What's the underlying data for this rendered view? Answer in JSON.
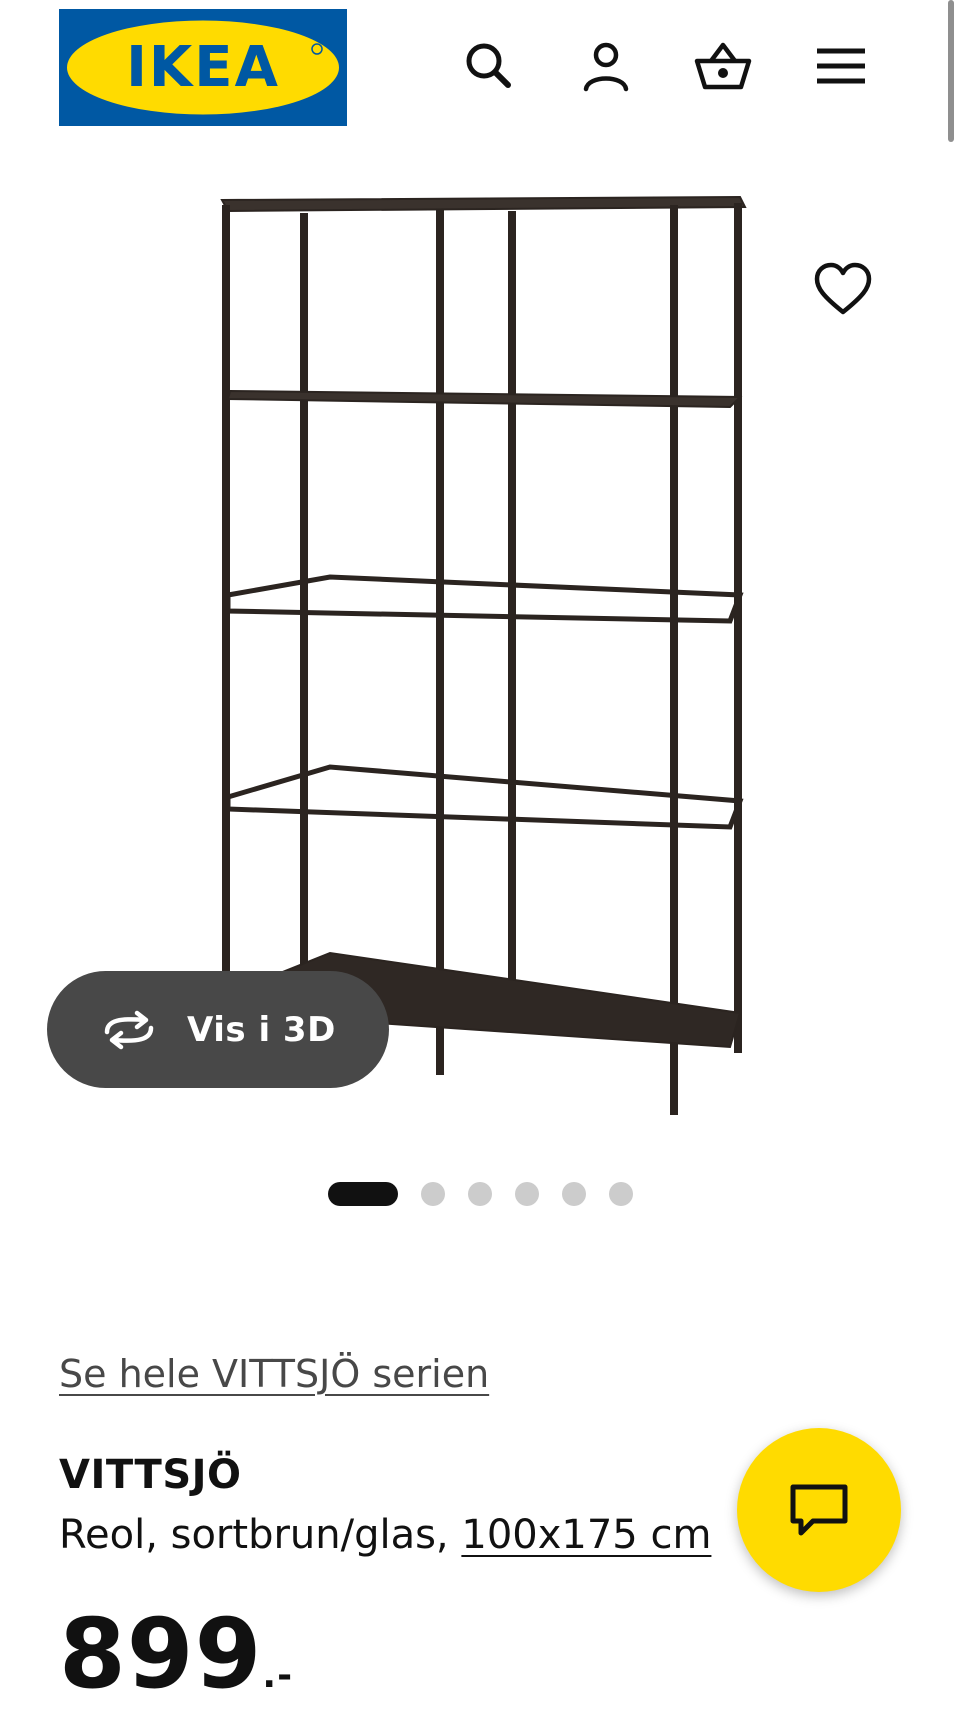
{
  "brand": {
    "logo_text": "IKEA",
    "colors": {
      "blue": "#0058a3",
      "yellow": "#ffdb00"
    }
  },
  "header": {
    "icons": [
      "search-icon",
      "user-icon",
      "basket-icon",
      "menu-icon"
    ]
  },
  "gallery": {
    "view_3d_label": "Vis i 3D",
    "total_images": 6,
    "active_index": 0
  },
  "product": {
    "series_link": "Se hele VITTSJÖ serien",
    "name": "VITTSJÖ",
    "description": "Reol, sortbrun/glas, ",
    "size": "100x175 cm",
    "price": "899",
    "price_suffix": ".-"
  },
  "colors": {
    "button_dark": "#484848",
    "text": "#111111",
    "dot_inactive": "#cccccc"
  }
}
